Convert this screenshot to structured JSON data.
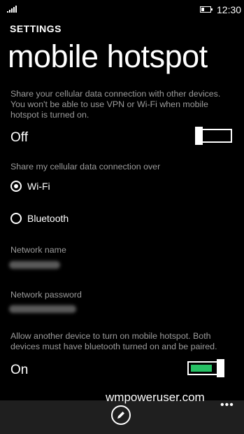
{
  "status_bar": {
    "time": "12:30",
    "signal_icon": "signal-bars-icon",
    "battery_icon": "battery-icon"
  },
  "header": {
    "settings_label": "SETTINGS",
    "title": "mobile hotspot"
  },
  "hotspot": {
    "description": "Share your cellular data connection with other devices. You won't be able to use VPN or Wi-Fi when mobile hotspot is turned on.",
    "state_label": "Off",
    "enabled": false
  },
  "share_over": {
    "label": "Share my cellular data connection over",
    "options": [
      {
        "label": "Wi-Fi",
        "selected": true
      },
      {
        "label": "Bluetooth",
        "selected": false
      }
    ]
  },
  "network": {
    "name_label": "Network name",
    "password_label": "Network password"
  },
  "remote_enable": {
    "description": "Allow another device to turn on mobile hotspot. Both devices must have bluetooth turned on and be paired.",
    "state_label": "On",
    "enabled": true,
    "accent_color": "#27c165"
  },
  "app_bar": {
    "edit_icon": "pencil-icon",
    "more_label": "•••"
  },
  "watermark": "wmpoweruser.com"
}
